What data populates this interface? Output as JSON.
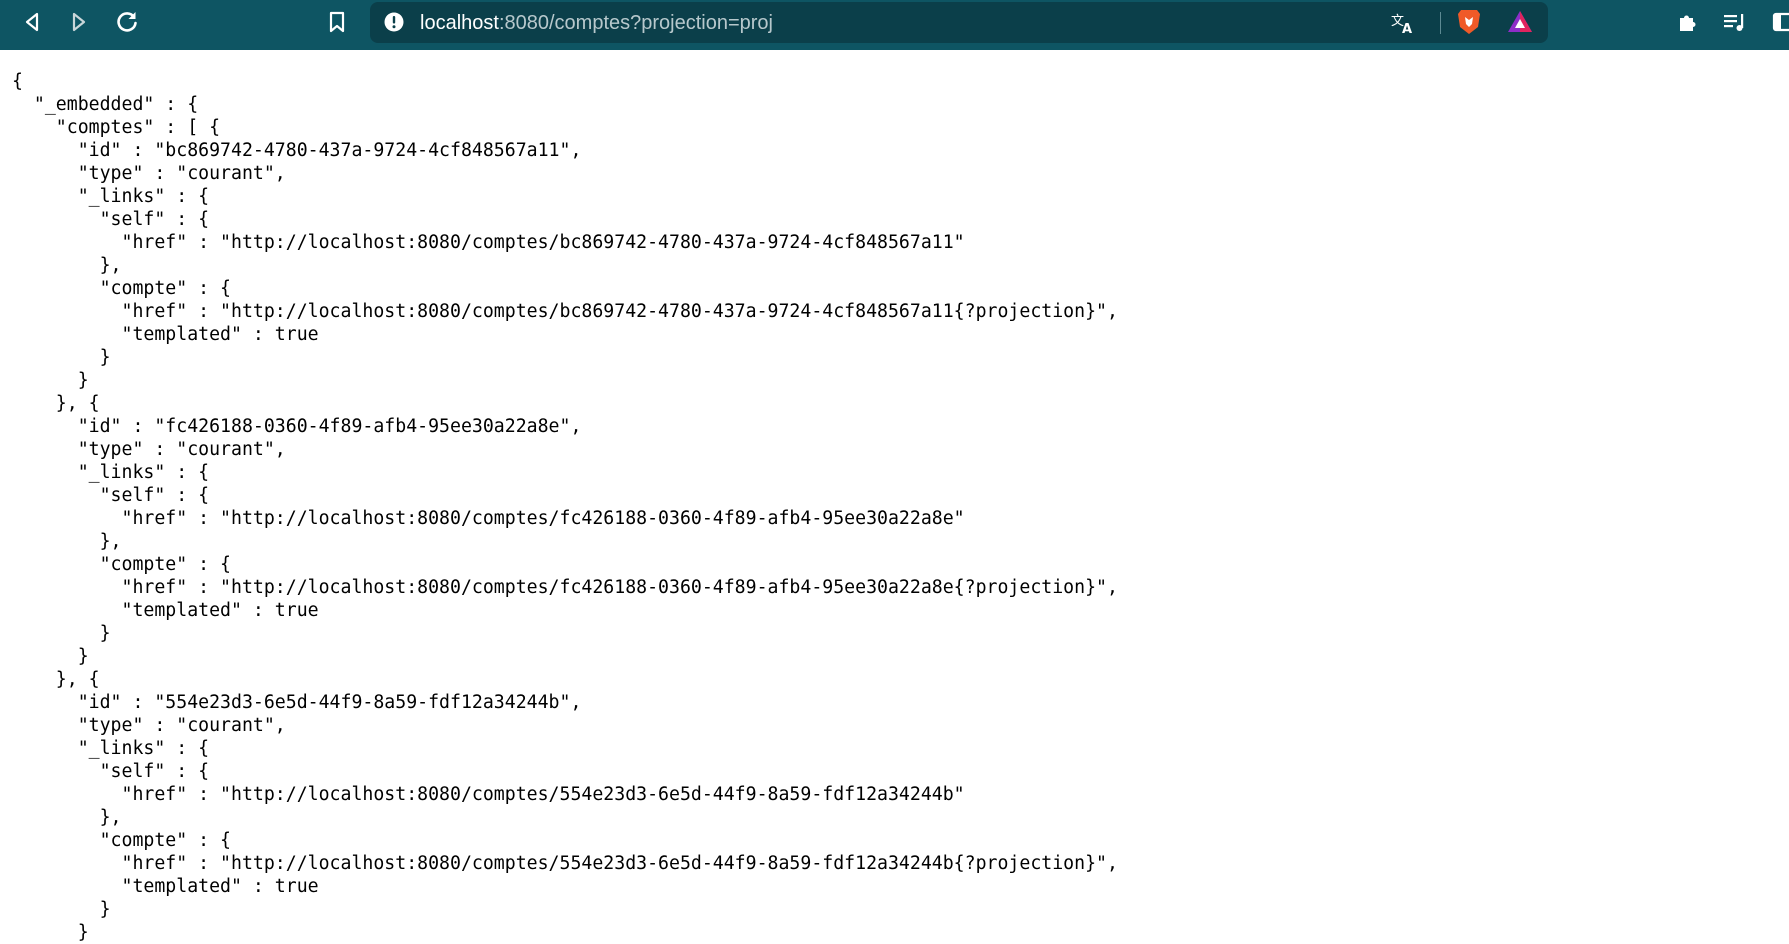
{
  "browser": {
    "url_host": "localhost",
    "url_rest": ":8080/comptes?projection=proj",
    "icons": [
      "back-icon",
      "forward-icon",
      "reload-icon",
      "bookmark-icon",
      "site-info-icon",
      "translate-icon",
      "brave-shields-icon",
      "brave-rewards-icon",
      "extensions-icon",
      "media-queue-icon",
      "sidebar-icon"
    ],
    "colors": {
      "toolbar": "#0e5563",
      "omnibox": "#0b3f4a",
      "shields": "#f05a28",
      "rewards": "#8e2dc8"
    }
  },
  "json_lines": [
    "{",
    "  \"_embedded\" : {",
    "    \"comptes\" : [ {",
    "      \"id\" : \"bc869742-4780-437a-9724-4cf848567a11\",",
    "      \"type\" : \"courant\",",
    "      \"_links\" : {",
    "        \"self\" : {",
    "          \"href\" : \"http://localhost:8080/comptes/bc869742-4780-437a-9724-4cf848567a11\"",
    "        },",
    "        \"compte\" : {",
    "          \"href\" : \"http://localhost:8080/comptes/bc869742-4780-437a-9724-4cf848567a11{?projection}\",",
    "          \"templated\" : true",
    "        }",
    "      }",
    "    }, {",
    "      \"id\" : \"fc426188-0360-4f89-afb4-95ee30a22a8e\",",
    "      \"type\" : \"courant\",",
    "      \"_links\" : {",
    "        \"self\" : {",
    "          \"href\" : \"http://localhost:8080/comptes/fc426188-0360-4f89-afb4-95ee30a22a8e\"",
    "        },",
    "        \"compte\" : {",
    "          \"href\" : \"http://localhost:8080/comptes/fc426188-0360-4f89-afb4-95ee30a22a8e{?projection}\",",
    "          \"templated\" : true",
    "        }",
    "      }",
    "    }, {",
    "      \"id\" : \"554e23d3-6e5d-44f9-8a59-fdf12a34244b\",",
    "      \"type\" : \"courant\",",
    "      \"_links\" : {",
    "        \"self\" : {",
    "          \"href\" : \"http://localhost:8080/comptes/554e23d3-6e5d-44f9-8a59-fdf12a34244b\"",
    "        },",
    "        \"compte\" : {",
    "          \"href\" : \"http://localhost:8080/comptes/554e23d3-6e5d-44f9-8a59-fdf12a34244b{?projection}\",",
    "          \"templated\" : true",
    "        }",
    "      }"
  ]
}
